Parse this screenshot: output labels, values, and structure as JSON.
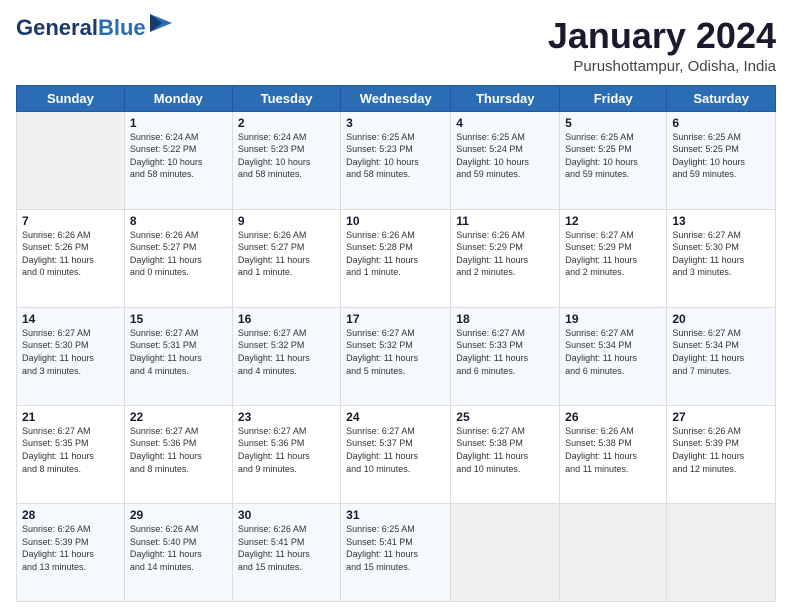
{
  "header": {
    "logo_line1": "General",
    "logo_line2": "Blue",
    "month_title": "January 2024",
    "location": "Purushottampur, Odisha, India"
  },
  "days_of_week": [
    "Sunday",
    "Monday",
    "Tuesday",
    "Wednesday",
    "Thursday",
    "Friday",
    "Saturday"
  ],
  "weeks": [
    [
      {
        "day": "",
        "info": ""
      },
      {
        "day": "1",
        "info": "Sunrise: 6:24 AM\nSunset: 5:22 PM\nDaylight: 10 hours\nand 58 minutes."
      },
      {
        "day": "2",
        "info": "Sunrise: 6:24 AM\nSunset: 5:23 PM\nDaylight: 10 hours\nand 58 minutes."
      },
      {
        "day": "3",
        "info": "Sunrise: 6:25 AM\nSunset: 5:23 PM\nDaylight: 10 hours\nand 58 minutes."
      },
      {
        "day": "4",
        "info": "Sunrise: 6:25 AM\nSunset: 5:24 PM\nDaylight: 10 hours\nand 59 minutes."
      },
      {
        "day": "5",
        "info": "Sunrise: 6:25 AM\nSunset: 5:25 PM\nDaylight: 10 hours\nand 59 minutes."
      },
      {
        "day": "6",
        "info": "Sunrise: 6:25 AM\nSunset: 5:25 PM\nDaylight: 10 hours\nand 59 minutes."
      }
    ],
    [
      {
        "day": "7",
        "info": "Sunrise: 6:26 AM\nSunset: 5:26 PM\nDaylight: 11 hours\nand 0 minutes."
      },
      {
        "day": "8",
        "info": "Sunrise: 6:26 AM\nSunset: 5:27 PM\nDaylight: 11 hours\nand 0 minutes."
      },
      {
        "day": "9",
        "info": "Sunrise: 6:26 AM\nSunset: 5:27 PM\nDaylight: 11 hours\nand 1 minute."
      },
      {
        "day": "10",
        "info": "Sunrise: 6:26 AM\nSunset: 5:28 PM\nDaylight: 11 hours\nand 1 minute."
      },
      {
        "day": "11",
        "info": "Sunrise: 6:26 AM\nSunset: 5:29 PM\nDaylight: 11 hours\nand 2 minutes."
      },
      {
        "day": "12",
        "info": "Sunrise: 6:27 AM\nSunset: 5:29 PM\nDaylight: 11 hours\nand 2 minutes."
      },
      {
        "day": "13",
        "info": "Sunrise: 6:27 AM\nSunset: 5:30 PM\nDaylight: 11 hours\nand 3 minutes."
      }
    ],
    [
      {
        "day": "14",
        "info": "Sunrise: 6:27 AM\nSunset: 5:30 PM\nDaylight: 11 hours\nand 3 minutes."
      },
      {
        "day": "15",
        "info": "Sunrise: 6:27 AM\nSunset: 5:31 PM\nDaylight: 11 hours\nand 4 minutes."
      },
      {
        "day": "16",
        "info": "Sunrise: 6:27 AM\nSunset: 5:32 PM\nDaylight: 11 hours\nand 4 minutes."
      },
      {
        "day": "17",
        "info": "Sunrise: 6:27 AM\nSunset: 5:32 PM\nDaylight: 11 hours\nand 5 minutes."
      },
      {
        "day": "18",
        "info": "Sunrise: 6:27 AM\nSunset: 5:33 PM\nDaylight: 11 hours\nand 6 minutes."
      },
      {
        "day": "19",
        "info": "Sunrise: 6:27 AM\nSunset: 5:34 PM\nDaylight: 11 hours\nand 6 minutes."
      },
      {
        "day": "20",
        "info": "Sunrise: 6:27 AM\nSunset: 5:34 PM\nDaylight: 11 hours\nand 7 minutes."
      }
    ],
    [
      {
        "day": "21",
        "info": "Sunrise: 6:27 AM\nSunset: 5:35 PM\nDaylight: 11 hours\nand 8 minutes."
      },
      {
        "day": "22",
        "info": "Sunrise: 6:27 AM\nSunset: 5:36 PM\nDaylight: 11 hours\nand 8 minutes."
      },
      {
        "day": "23",
        "info": "Sunrise: 6:27 AM\nSunset: 5:36 PM\nDaylight: 11 hours\nand 9 minutes."
      },
      {
        "day": "24",
        "info": "Sunrise: 6:27 AM\nSunset: 5:37 PM\nDaylight: 11 hours\nand 10 minutes."
      },
      {
        "day": "25",
        "info": "Sunrise: 6:27 AM\nSunset: 5:38 PM\nDaylight: 11 hours\nand 10 minutes."
      },
      {
        "day": "26",
        "info": "Sunrise: 6:26 AM\nSunset: 5:38 PM\nDaylight: 11 hours\nand 11 minutes."
      },
      {
        "day": "27",
        "info": "Sunrise: 6:26 AM\nSunset: 5:39 PM\nDaylight: 11 hours\nand 12 minutes."
      }
    ],
    [
      {
        "day": "28",
        "info": "Sunrise: 6:26 AM\nSunset: 5:39 PM\nDaylight: 11 hours\nand 13 minutes."
      },
      {
        "day": "29",
        "info": "Sunrise: 6:26 AM\nSunset: 5:40 PM\nDaylight: 11 hours\nand 14 minutes."
      },
      {
        "day": "30",
        "info": "Sunrise: 6:26 AM\nSunset: 5:41 PM\nDaylight: 11 hours\nand 15 minutes."
      },
      {
        "day": "31",
        "info": "Sunrise: 6:25 AM\nSunset: 5:41 PM\nDaylight: 11 hours\nand 15 minutes."
      },
      {
        "day": "",
        "info": ""
      },
      {
        "day": "",
        "info": ""
      },
      {
        "day": "",
        "info": ""
      }
    ]
  ]
}
